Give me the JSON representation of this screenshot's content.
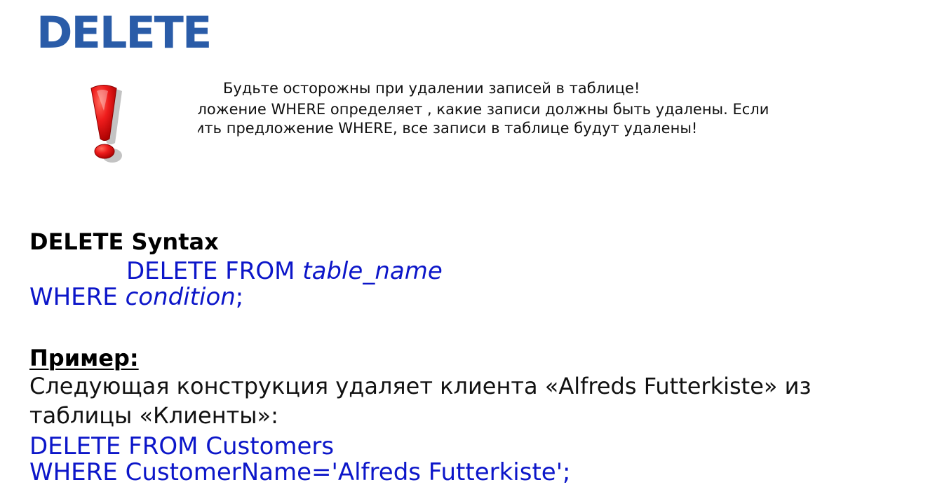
{
  "slide": {
    "title": "DELETE",
    "warning": {
      "icon": "exclamation-icon",
      "icon_color": "#e01010",
      "line1": "Будьте осторожны при удалении записей в таблице!",
      "line2": "едложение WHERE определяет , какие записи должны быть удалены. Если",
      "line3": "стить предложение WHERE, все записи в таблице будут удалены!"
    },
    "syntax": {
      "heading": "DELETE Syntax",
      "line1_keyword": "DELETE FROM ",
      "line1_param": "table_name",
      "line2_keyword": "WHERE ",
      "line2_param": "condition",
      "line2_end": ";"
    },
    "example": {
      "heading": "Пример:",
      "description": "Следующая конструкция удаляет клиента «Alfreds Futterkiste» из таблицы «Клиенты»:",
      "code_line1": "DELETE FROM Customers",
      "code_line2": "WHERE CustomerName='Alfreds Futterkiste';"
    },
    "colors": {
      "title": "#2a5ca8",
      "code": "#0c16c9",
      "text": "#111111"
    }
  }
}
